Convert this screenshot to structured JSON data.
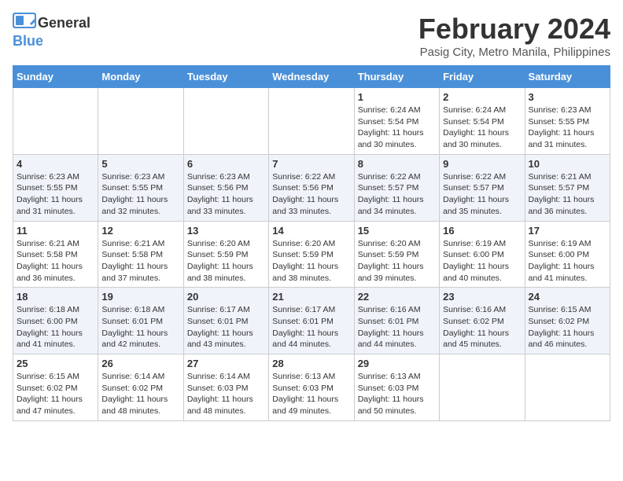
{
  "logo": {
    "general": "General",
    "blue": "Blue"
  },
  "title": {
    "month": "February 2024",
    "location": "Pasig City, Metro Manila, Philippines"
  },
  "days_of_week": [
    "Sunday",
    "Monday",
    "Tuesday",
    "Wednesday",
    "Thursday",
    "Friday",
    "Saturday"
  ],
  "weeks": [
    [
      {
        "day": "",
        "info": ""
      },
      {
        "day": "",
        "info": ""
      },
      {
        "day": "",
        "info": ""
      },
      {
        "day": "",
        "info": ""
      },
      {
        "day": "1",
        "info": "Sunrise: 6:24 AM\nSunset: 5:54 PM\nDaylight: 11 hours\nand 30 minutes."
      },
      {
        "day": "2",
        "info": "Sunrise: 6:24 AM\nSunset: 5:54 PM\nDaylight: 11 hours\nand 30 minutes."
      },
      {
        "day": "3",
        "info": "Sunrise: 6:23 AM\nSunset: 5:55 PM\nDaylight: 11 hours\nand 31 minutes."
      }
    ],
    [
      {
        "day": "4",
        "info": "Sunrise: 6:23 AM\nSunset: 5:55 PM\nDaylight: 11 hours\nand 31 minutes."
      },
      {
        "day": "5",
        "info": "Sunrise: 6:23 AM\nSunset: 5:55 PM\nDaylight: 11 hours\nand 32 minutes."
      },
      {
        "day": "6",
        "info": "Sunrise: 6:23 AM\nSunset: 5:56 PM\nDaylight: 11 hours\nand 33 minutes."
      },
      {
        "day": "7",
        "info": "Sunrise: 6:22 AM\nSunset: 5:56 PM\nDaylight: 11 hours\nand 33 minutes."
      },
      {
        "day": "8",
        "info": "Sunrise: 6:22 AM\nSunset: 5:57 PM\nDaylight: 11 hours\nand 34 minutes."
      },
      {
        "day": "9",
        "info": "Sunrise: 6:22 AM\nSunset: 5:57 PM\nDaylight: 11 hours\nand 35 minutes."
      },
      {
        "day": "10",
        "info": "Sunrise: 6:21 AM\nSunset: 5:57 PM\nDaylight: 11 hours\nand 36 minutes."
      }
    ],
    [
      {
        "day": "11",
        "info": "Sunrise: 6:21 AM\nSunset: 5:58 PM\nDaylight: 11 hours\nand 36 minutes."
      },
      {
        "day": "12",
        "info": "Sunrise: 6:21 AM\nSunset: 5:58 PM\nDaylight: 11 hours\nand 37 minutes."
      },
      {
        "day": "13",
        "info": "Sunrise: 6:20 AM\nSunset: 5:59 PM\nDaylight: 11 hours\nand 38 minutes."
      },
      {
        "day": "14",
        "info": "Sunrise: 6:20 AM\nSunset: 5:59 PM\nDaylight: 11 hours\nand 38 minutes."
      },
      {
        "day": "15",
        "info": "Sunrise: 6:20 AM\nSunset: 5:59 PM\nDaylight: 11 hours\nand 39 minutes."
      },
      {
        "day": "16",
        "info": "Sunrise: 6:19 AM\nSunset: 6:00 PM\nDaylight: 11 hours\nand 40 minutes."
      },
      {
        "day": "17",
        "info": "Sunrise: 6:19 AM\nSunset: 6:00 PM\nDaylight: 11 hours\nand 41 minutes."
      }
    ],
    [
      {
        "day": "18",
        "info": "Sunrise: 6:18 AM\nSunset: 6:00 PM\nDaylight: 11 hours\nand 41 minutes."
      },
      {
        "day": "19",
        "info": "Sunrise: 6:18 AM\nSunset: 6:01 PM\nDaylight: 11 hours\nand 42 minutes."
      },
      {
        "day": "20",
        "info": "Sunrise: 6:17 AM\nSunset: 6:01 PM\nDaylight: 11 hours\nand 43 minutes."
      },
      {
        "day": "21",
        "info": "Sunrise: 6:17 AM\nSunset: 6:01 PM\nDaylight: 11 hours\nand 44 minutes."
      },
      {
        "day": "22",
        "info": "Sunrise: 6:16 AM\nSunset: 6:01 PM\nDaylight: 11 hours\nand 44 minutes."
      },
      {
        "day": "23",
        "info": "Sunrise: 6:16 AM\nSunset: 6:02 PM\nDaylight: 11 hours\nand 45 minutes."
      },
      {
        "day": "24",
        "info": "Sunrise: 6:15 AM\nSunset: 6:02 PM\nDaylight: 11 hours\nand 46 minutes."
      }
    ],
    [
      {
        "day": "25",
        "info": "Sunrise: 6:15 AM\nSunset: 6:02 PM\nDaylight: 11 hours\nand 47 minutes."
      },
      {
        "day": "26",
        "info": "Sunrise: 6:14 AM\nSunset: 6:02 PM\nDaylight: 11 hours\nand 48 minutes."
      },
      {
        "day": "27",
        "info": "Sunrise: 6:14 AM\nSunset: 6:03 PM\nDaylight: 11 hours\nand 48 minutes."
      },
      {
        "day": "28",
        "info": "Sunrise: 6:13 AM\nSunset: 6:03 PM\nDaylight: 11 hours\nand 49 minutes."
      },
      {
        "day": "29",
        "info": "Sunrise: 6:13 AM\nSunset: 6:03 PM\nDaylight: 11 hours\nand 50 minutes."
      },
      {
        "day": "",
        "info": ""
      },
      {
        "day": "",
        "info": ""
      }
    ]
  ]
}
